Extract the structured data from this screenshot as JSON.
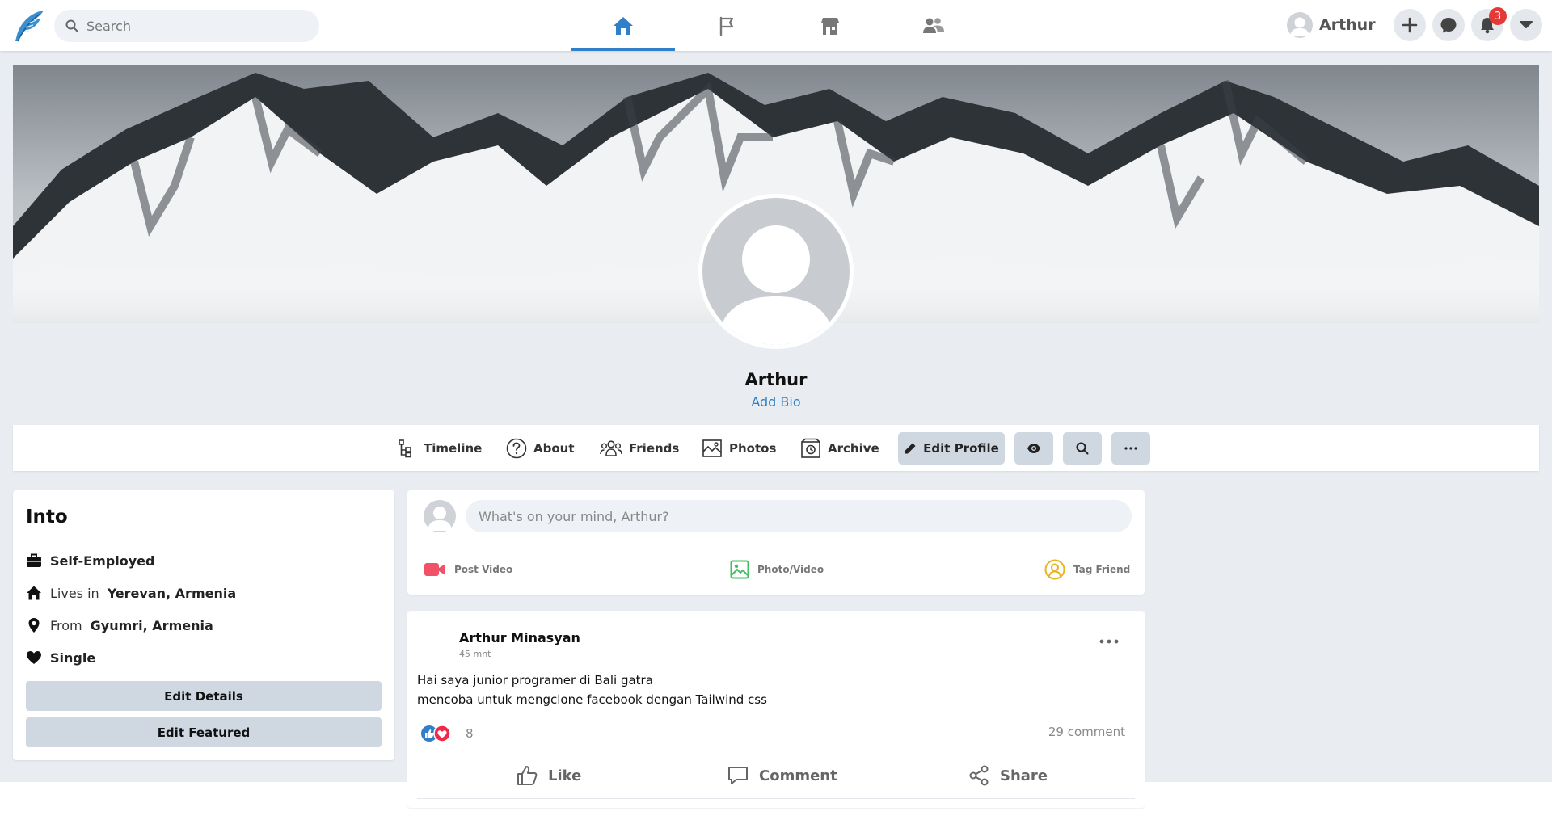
{
  "topbar": {
    "search_placeholder": "Search",
    "nav_tabs": [
      {
        "name": "home",
        "icon": "home-icon",
        "active": true
      },
      {
        "name": "pages",
        "icon": "flag-icon",
        "active": false
      },
      {
        "name": "marketplace",
        "icon": "store-icon",
        "active": false
      },
      {
        "name": "groups",
        "icon": "users-icon",
        "active": false
      }
    ],
    "user_name": "Arthur",
    "notification_count": "3",
    "accent_color": "#2f80c9"
  },
  "profile": {
    "name": "Arthur",
    "add_bio_label": "Add Bio"
  },
  "profile_tabs": {
    "timeline": "Timeline",
    "about": "About",
    "friends": "Friends",
    "photos": "Photos",
    "archive": "Archive",
    "edit_profile": "Edit Profile"
  },
  "intro": {
    "title": "Into",
    "work": "Self-Employed",
    "lives_prefix": "Lives in",
    "lives_value": "Yerevan, Armenia",
    "from_prefix": "From",
    "from_value": "Gyumri, Armenia",
    "relationship": "Single",
    "edit_details": "Edit Details",
    "edit_featured": "Edit Featured"
  },
  "composer": {
    "placeholder": "What's on your mind, Arthur?",
    "actions": {
      "video": "Post Video",
      "photo": "Photo/Video",
      "tag": "Tag Friend"
    },
    "colors": {
      "video": "#f25268",
      "photo": "#45bd62",
      "tag": "#e9b51f"
    }
  },
  "post": {
    "author": "Arthur Minasyan",
    "time": "45 mnt",
    "lines": [
      "Hai saya junior programer di Bali gatra",
      "mencoba untuk mengclone facebook dengan Tailwind css"
    ],
    "reaction_count": "8",
    "comment_count": "29 comment",
    "actions": {
      "like": "Like",
      "comment": "Comment",
      "share": "Share"
    }
  }
}
